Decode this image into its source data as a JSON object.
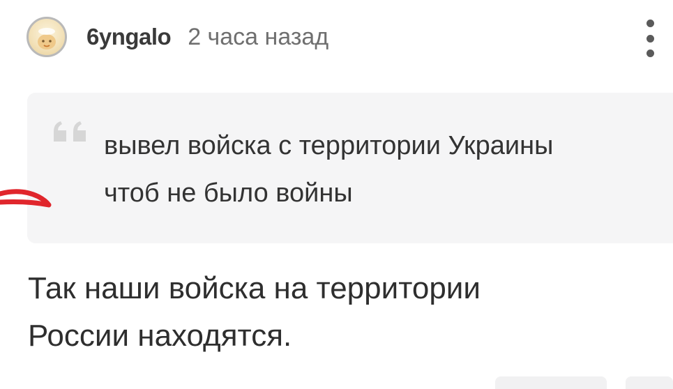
{
  "comment": {
    "author": {
      "username": "6yngalo",
      "avatar": "avatar-image"
    },
    "timestamp": "2 часа назад",
    "menu_icon": "more-vertical-icon",
    "quote": {
      "icon": "quote-mark-icon",
      "line1": "вывел войска с территории Украины",
      "line2": "чтоб не было войны"
    },
    "reply": {
      "line1": "Так наши войска на территории",
      "line2": "России находятся."
    }
  },
  "colors": {
    "quote_background": "#f5f5f6",
    "annotation_stroke": "#e0262c",
    "quote_mark": "#d6d6d6"
  }
}
